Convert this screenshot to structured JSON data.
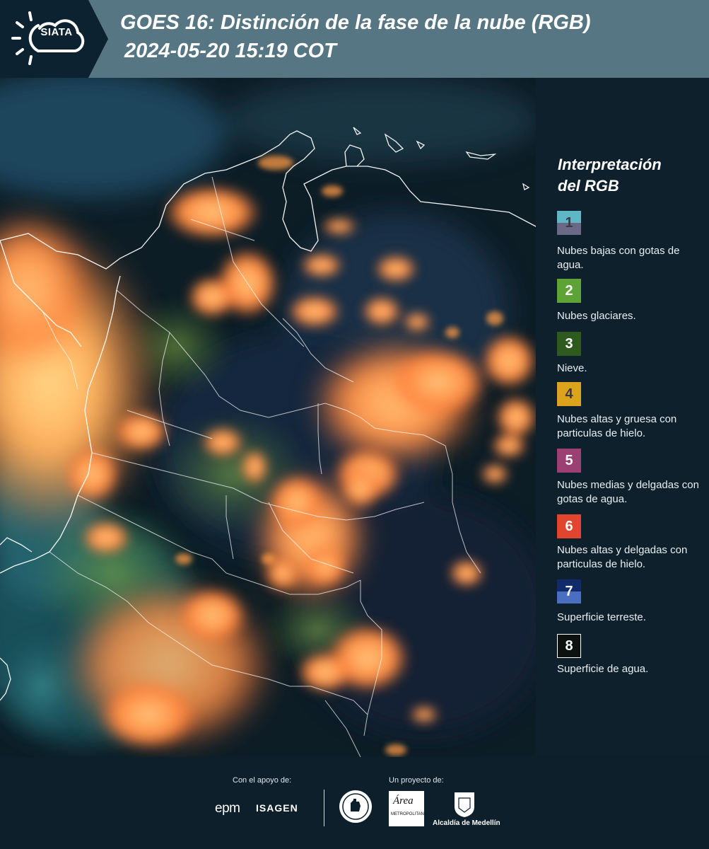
{
  "header": {
    "logo_text": "SIATA",
    "title": "GOES 16: Distinción de la fase de la nube (RGB)",
    "timestamp": "2024-05-20 15:19 COT"
  },
  "legend": {
    "title_line1": "Interpretación",
    "title_line2": "del RGB",
    "items": [
      {
        "number": "1",
        "text": "Nubes bajas con gotas de agua.",
        "color_top": "#5fb7c5",
        "color_bottom": "#6a6a86",
        "number_color": "#3a3a4a"
      },
      {
        "number": "2",
        "text": "Nubes glaciares.",
        "color_top": "#5ea336",
        "color_bottom": "#5ea336",
        "number_color": "#ffffff"
      },
      {
        "number": "3",
        "text": "Nieve.",
        "color_top": "#2f5a1f",
        "color_bottom": "#2f5a1f",
        "number_color": "#ffffff"
      },
      {
        "number": "4",
        "text": "Nubes altas y gruesa con particulas de hielo.",
        "color_top": "#dca31c",
        "color_bottom": "#dca31c",
        "number_color": "#3a3a3a"
      },
      {
        "number": "5",
        "text": "Nubes medias y delgadas con gotas de agua.",
        "color_top": "#9c3f73",
        "color_bottom": "#9c3f73",
        "number_color": "#ffffff"
      },
      {
        "number": "6",
        "text": "Nubes altas y delgadas con particulas de hielo.",
        "color_top": "#e1452d",
        "color_bottom": "#e1452d",
        "number_color": "#ffffff"
      },
      {
        "number": "7",
        "text": "Superficie terreste.",
        "color_top": "#102a6a",
        "color_bottom": "#4a6fc0",
        "number_color": "#ffffff"
      },
      {
        "number": "8",
        "text": "Superficie de agua.",
        "color_top": "#0b1210",
        "color_bottom": "#0b1210",
        "number_color": "#ffffff"
      }
    ]
  },
  "footer": {
    "support_label": "Con el apoyo de:",
    "project_label": "Un proyecto de:",
    "epm": "epm",
    "isagen": "ISAGEN",
    "area_text": "Área",
    "area_sub": "METROPOLITANA",
    "alcaldia": "Alcaldía de Medellín"
  },
  "colors": {
    "header_band": "#557682",
    "background": "#0c1f2a",
    "cloud_orange": "#ff9a45",
    "cloud_yellow": "#ffd27a",
    "border_white": "#ffffff"
  }
}
